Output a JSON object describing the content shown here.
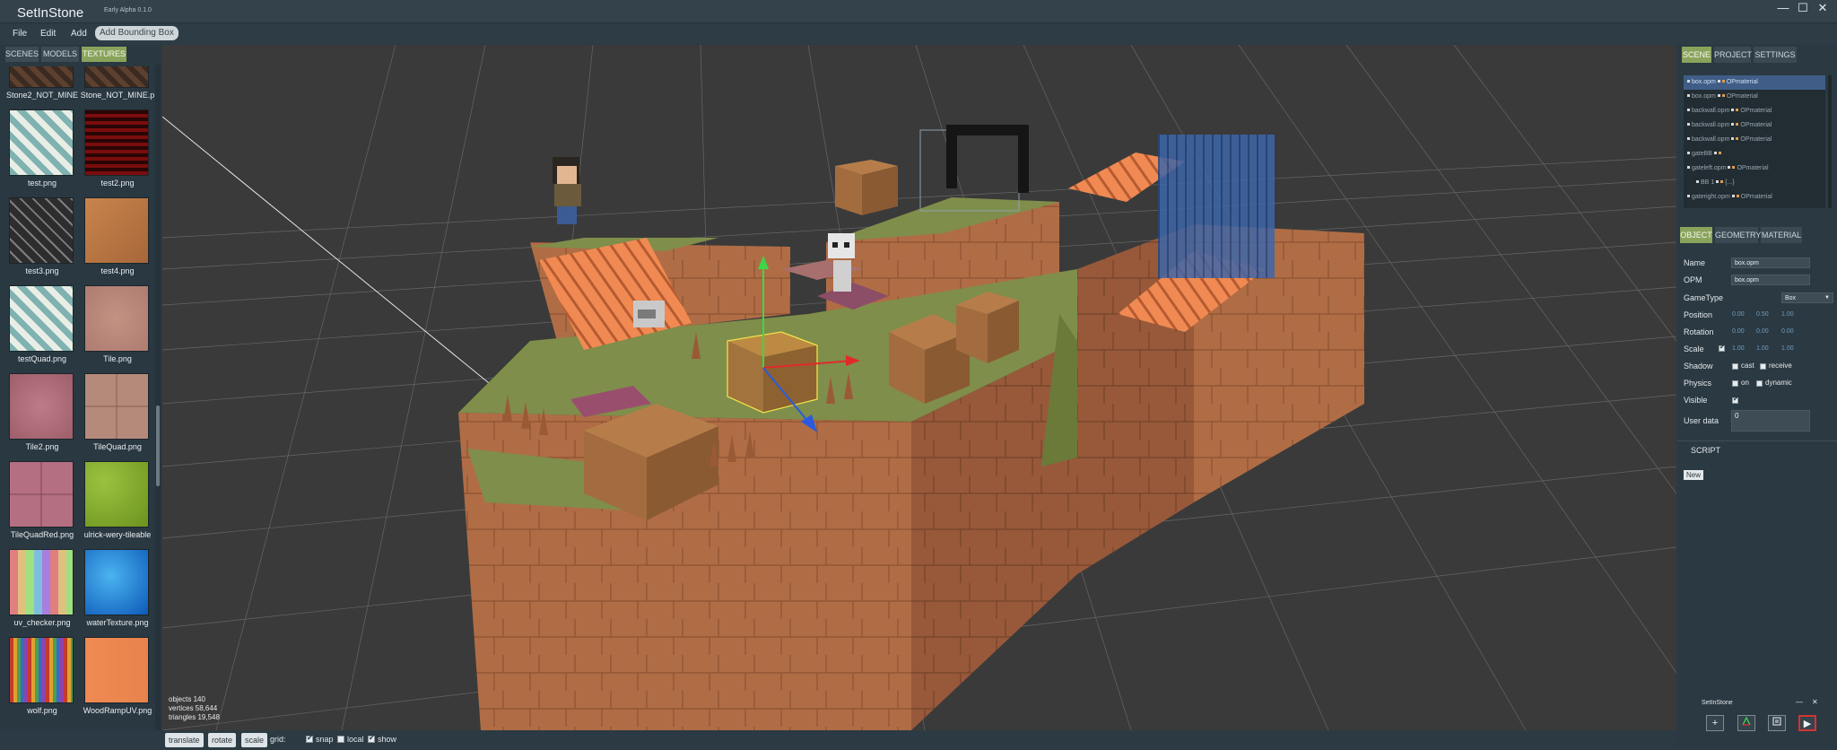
{
  "app": {
    "title": "SetInStone",
    "version": "Early Alpha 0.1.0"
  },
  "window_controls": {
    "minimize": "—",
    "maximize": "☐",
    "close": "✕"
  },
  "menu": {
    "file": "File",
    "edit": "Edit",
    "add": "Add",
    "add_bbox": "Add Bounding Box"
  },
  "left_tabs": {
    "scenes": "SCENES",
    "models": "MODELS",
    "textures": "TEXTURES",
    "active": "TEXTURES"
  },
  "textures": [
    {
      "label": "Stone2_NOT_MINE",
      "icon": "stone-texture"
    },
    {
      "label": "Stone_NOT_MINE.p",
      "icon": "stone-texture"
    },
    {
      "label": "test.png",
      "icon": "plaid-texture"
    },
    {
      "label": "test2.png",
      "icon": "red-plaid-texture"
    },
    {
      "label": "test3.png",
      "icon": "herringbone-texture"
    },
    {
      "label": "test4.png",
      "icon": "crate-texture"
    },
    {
      "label": "testQuad.png",
      "icon": "plaid-texture"
    },
    {
      "label": "Tile.png",
      "icon": "tile-texture"
    },
    {
      "label": "Tile2.png",
      "icon": "pink-tile-texture"
    },
    {
      "label": "TileQuad.png",
      "icon": "tile-quad-texture"
    },
    {
      "label": "TileQuadRed.png",
      "icon": "pink-tile-quad-texture"
    },
    {
      "label": "ulrick-wery-tileable",
      "icon": "grass-texture"
    },
    {
      "label": "uv_checker.png",
      "icon": "uv-checker-texture"
    },
    {
      "label": "waterTexture.png",
      "icon": "water-texture"
    },
    {
      "label": "wolf.png",
      "icon": "palette-stripes-texture"
    },
    {
      "label": "WoodRampUV.png",
      "icon": "orange-ramp-texture"
    }
  ],
  "stats": {
    "objects": "objects  140",
    "vertices": "vertices  58,644",
    "triangles": "triangles  19,548"
  },
  "bottom_bar": {
    "translate": "translate",
    "rotate": "rotate",
    "scale": "scale",
    "grid_label": "grid:",
    "snap": "snap",
    "local": "local",
    "show": "show",
    "snap_checked": true,
    "local_checked": false,
    "show_checked": true
  },
  "right_tabs": {
    "scene": "SCENE",
    "project": "PROJECT",
    "settings": "SETTINGS"
  },
  "scene_tree": [
    {
      "name": "box.opm",
      "material": "OPmaterial",
      "selected": true
    },
    {
      "name": "box.opm",
      "material": "OPmaterial",
      "selected": false
    },
    {
      "name": "backwall.opm",
      "material": "OPmaterial",
      "selected": false
    },
    {
      "name": "backwall.opm",
      "material": "OPmaterial",
      "selected": false
    },
    {
      "name": "backwall.opm",
      "material": "OPmaterial",
      "selected": false
    },
    {
      "name": "gateBB",
      "material": "",
      "selected": false
    },
    {
      "name": "gateleft.opm",
      "material": "OPmaterial",
      "selected": false
    },
    {
      "name": "BB 1",
      "material": "{...}",
      "selected": false
    },
    {
      "name": "gateright.opm",
      "material": "OPmaterial",
      "selected": false
    }
  ],
  "prop_tabs": {
    "object": "OBJECT",
    "geometry": "GEOMETRY",
    "material": "MATERIAL"
  },
  "props": {
    "name_label": "Name",
    "name_value": "box.opm",
    "opm_label": "OPM",
    "opm_value": "box.opm",
    "gametype_label": "GameType",
    "gametype_value": "Box",
    "position_label": "Position",
    "position_values": [
      "0.00",
      "0.50",
      "1.00"
    ],
    "rotation_label": "Rotation",
    "rotation_values": [
      "0.00",
      "0.00",
      "0.00"
    ],
    "scale_label": "Scale",
    "scale_values": [
      "1.00",
      "1.00",
      "1.00"
    ],
    "shadow_label": "Shadow",
    "cast": "cast",
    "receive": "receive",
    "physics_label": "Physics",
    "on": "on",
    "dynamic": "dynamic",
    "visible_label": "Visible",
    "userdata_label": "User data",
    "userdata_value": "0"
  },
  "script": {
    "header": "SCRIPT",
    "new_button": "New"
  },
  "mini_window": {
    "title": "SetInStone",
    "add_icon": "+",
    "play_icon": "▶"
  },
  "colors": {
    "accent_tab": "#8aa35c",
    "panel_bg": "#2b3942",
    "viewport_bg": "#3a3a3a",
    "selection": "#3f5d86"
  }
}
